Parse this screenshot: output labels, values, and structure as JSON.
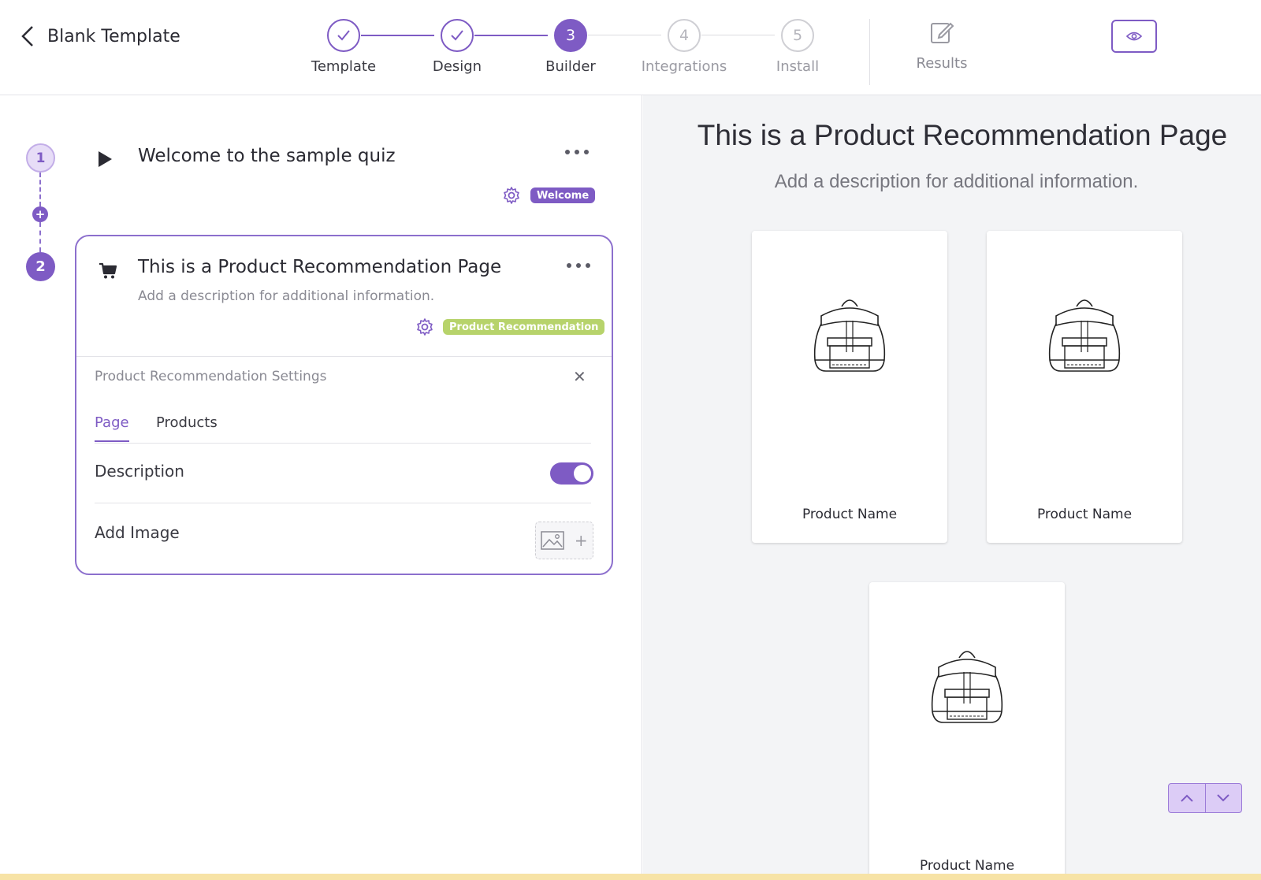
{
  "header": {
    "back_label": "Blank Template",
    "steps": [
      {
        "number": "1",
        "label": "Template",
        "state": "done"
      },
      {
        "number": "2",
        "label": "Design",
        "state": "done"
      },
      {
        "number": "3",
        "label": "Builder",
        "state": "active"
      },
      {
        "number": "4",
        "label": "Integrations",
        "state": "todo"
      },
      {
        "number": "5",
        "label": "Install",
        "state": "todo"
      }
    ],
    "results_label": "Results",
    "preview_icon": "eye-icon"
  },
  "builder": {
    "questions": [
      {
        "number": "1",
        "icon": "play-icon",
        "title": "Welcome to the sample quiz",
        "badge": "Welcome"
      },
      {
        "number": "2",
        "icon": "cart-icon",
        "title": "This is a Product Recommendation Page",
        "description": "Add a description for additional information.",
        "badge": "Product Recommendation"
      }
    ],
    "settings": {
      "title": "Product Recommendation Settings",
      "tabs": [
        "Page",
        "Products"
      ],
      "active_tab": "Page",
      "description_label": "Description",
      "description_enabled": true,
      "add_image_label": "Add Image"
    }
  },
  "preview": {
    "title": "This is a Product Recommendation Page",
    "description": "Add a description for additional information.",
    "products": [
      {
        "name": "Product Name",
        "image": "backpack-icon"
      },
      {
        "name": "Product Name",
        "image": "backpack-icon"
      },
      {
        "name": "Product Name",
        "image": "backpack-icon"
      }
    ]
  },
  "colors": {
    "accent": "#7e5bc4",
    "welcome_badge": "#7e5bc4",
    "product_badge": "#b7d36b",
    "preview_bg": "#f3f4f6"
  }
}
